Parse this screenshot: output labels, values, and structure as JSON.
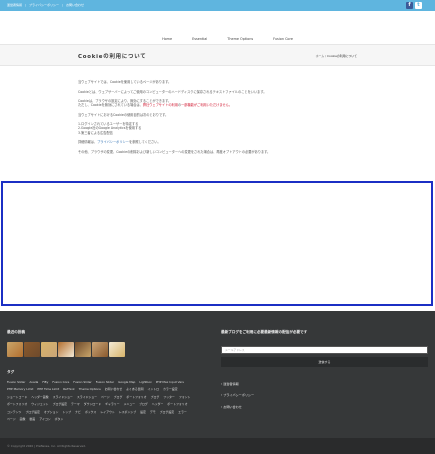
{
  "topbar": {
    "links": [
      "運営者情報",
      "プライバシーポリシー",
      "お問い合わせ"
    ],
    "social": [
      "f",
      "t"
    ]
  },
  "nav": {
    "items": [
      "Home",
      "Essential",
      "Theme Options",
      "Fusion Core"
    ]
  },
  "page": {
    "title": "Cookieの利用について",
    "breadcrumb_home": "ホーム",
    "breadcrumb_sep": "/",
    "breadcrumb_current": "Cookieの利用について"
  },
  "content": {
    "p1": "当ウェブサイトでは、Cookieを使用しているページがあります。",
    "p2": "Cookieとは、ウェブサーバーによってご使用のコンピューターのハードディスクに保存されるテキストファイルのことをいいます。",
    "p3a": "Cookieは、ブラウザの設定により、無効にすることができます。",
    "p3b_pre": "ただし、Cookieを無効にされている場合は、",
    "p3b_red": "弊社ウェブサイトの利用",
    "p3b_mid": "の",
    "p3b_red2": "一部機能がご利用いただけません。",
    "p4": "当ウェブサイトにおけるCookieの使用目的は次のとおりです。",
    "list1": "1.ログインされているユーザーを特定する",
    "list2": "2.Google社のGoogle Analyticsを使用する",
    "list3": "3.第三者による広告配信",
    "p5_pre": "詳細情報は、",
    "p5_link": "プライバシーポリシー",
    "p5_post": "を参照してください。",
    "p6": "その他、ブラウザの変更、Cookieの削除および新しいコンピューターへの変更をされた場合は、再度オプトアウトの必要があります。"
  },
  "footer": {
    "photos_title": "最近の投稿",
    "thumb_colors": [
      "#c9a56a",
      "#8a5a2e",
      "#d8b46a",
      "#b36f2f",
      "#6e4a2b",
      "#caa577",
      "#f3ead6"
    ],
    "tags_title": "タグ",
    "tags": [
      "Fusion Slider",
      "Avada",
      "Fifty",
      "Fusion Core",
      "Fusion Slider",
      "Fusion Slider",
      "Google Map",
      "Lightbox",
      "PHP Max Input Vars",
      "PHP Memory Limit",
      "PHP Time Limit",
      "ReThink",
      "Theme Options",
      "お問い合わせ",
      "よくある質問",
      "イントロ",
      "カラー設定",
      "ショートコード",
      "ヘッダー画像",
      "スライドショー",
      "スライドショー",
      "ページ",
      "ブログ",
      "ポートフォリオ",
      "ブログ",
      "フッター",
      "フォント",
      "ポートフォリオ",
      "ウィジェット",
      "ブログ設定",
      "テーマ",
      "ダウンロード",
      "ギャラリー",
      "メニュー",
      "ブログ",
      "ヘッダー",
      "ポートフォリオ",
      "コンテンツ",
      "ブログ設定",
      "オプション",
      "トップ",
      "ナビ",
      "ボックス",
      "レイアウト",
      "レスポンシブ",
      "設定",
      "デモ",
      "ブログ設定",
      "エラー",
      "ページ",
      "画像",
      "動画",
      "アイコン",
      "ボタン"
    ],
    "newsletter_title": "最新ブログをご利用に必要最新情報の配信が必要です",
    "newsletter_placeholder": "メールアドレス",
    "newsletter_button": "送信する",
    "links": [
      "運営者情報",
      "プライバシーポリシー",
      "お問い合わせ"
    ],
    "copyright": "© Copyright 2020 | Preflexes, Inc. All Rights Reserved."
  }
}
